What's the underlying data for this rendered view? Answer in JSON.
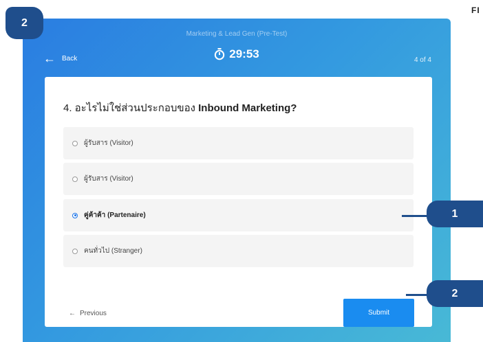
{
  "header": {
    "quiz_title": "Marketing & Lead Gen (Pre-Test)",
    "back_label": "Back",
    "timer": "29:53",
    "progress": "4 of 4"
  },
  "question": {
    "number_prefix": "4. อะไรไม่ใช่ส่วนประกอบของ ",
    "emphasis": "Inbound Marketing?"
  },
  "options": [
    {
      "label": "ผู้รับสาร (Visitor)",
      "selected": false
    },
    {
      "label": "ผู้รับสาร (Visitor)",
      "selected": false
    },
    {
      "label": "คู่ค้าค้า (Partenaire)",
      "selected": true
    },
    {
      "label": "คนทั่วไป (Stranger)",
      "selected": false
    }
  ],
  "footer": {
    "previous_label": "Previous",
    "submit_label": "Submit"
  },
  "annotations": {
    "step_badge": "2",
    "callout_option": "1",
    "callout_submit": "2",
    "corner_text": "FI"
  },
  "colors": {
    "frame_gradient_start": "#2a7de1",
    "frame_gradient_end": "#48b9d6",
    "submit_button": "#1a8cf0",
    "annotation": "#1f4e8c"
  },
  "icons": {
    "back": "arrow-left-icon",
    "timer": "stopwatch-icon",
    "previous": "arrow-left-icon"
  }
}
